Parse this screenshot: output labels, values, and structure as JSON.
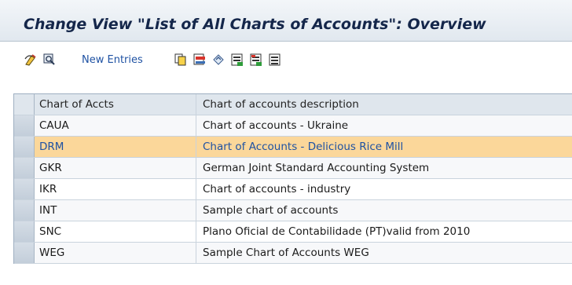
{
  "window": {
    "title": "Change View \"List of All Charts of Accounts\": Overview"
  },
  "toolbar": {
    "new_entries_label": "New Entries",
    "icons": [
      "display-change-icon",
      "select-icon",
      "copy-icon",
      "delete-icon",
      "undo-icon",
      "select-all-icon",
      "select-block-icon",
      "deselect-all-icon"
    ]
  },
  "table": {
    "columns": [
      "Chart of Accts",
      "Chart of accounts description"
    ],
    "rows": [
      {
        "code": "CAUA",
        "description": "Chart of accounts - Ukraine",
        "selected": false
      },
      {
        "code": "DRM",
        "description": "Chart of Accounts - Delicious Rice Mill",
        "selected": true
      },
      {
        "code": "GKR",
        "description": "German Joint Standard Accounting System",
        "selected": false
      },
      {
        "code": "IKR",
        "description": "Chart of accounts - industry",
        "selected": false
      },
      {
        "code": "INT",
        "description": "Sample chart of accounts",
        "selected": false
      },
      {
        "code": "SNC",
        "description": "Plano Oficial de Contabilidade (PT)valid from 2010",
        "selected": false
      },
      {
        "code": "WEG",
        "description": "Sample Chart of Accounts WEG",
        "selected": false
      }
    ]
  },
  "colors": {
    "selected_row": "#fbd79a",
    "link": "#1f52a3",
    "title": "#14264a"
  }
}
